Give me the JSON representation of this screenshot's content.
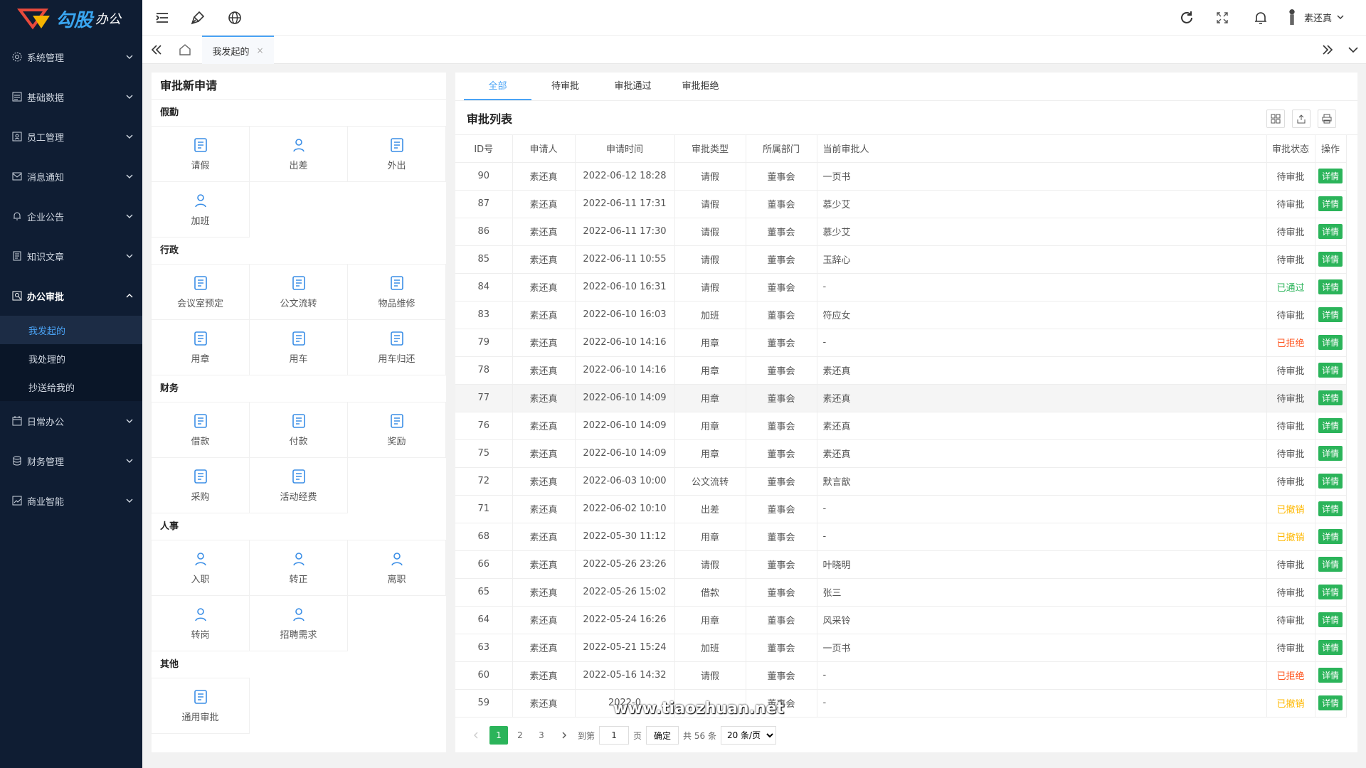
{
  "logo": {
    "brand": "勾股",
    "sub": "办公"
  },
  "sidebar": {
    "items": [
      {
        "label": "系统管理",
        "icon": "gear-icon"
      },
      {
        "label": "基础数据",
        "icon": "database-icon"
      },
      {
        "label": "员工管理",
        "icon": "badge-icon"
      },
      {
        "label": "消息通知",
        "icon": "mail-icon"
      },
      {
        "label": "企业公告",
        "icon": "bell-icon"
      },
      {
        "label": "知识文章",
        "icon": "article-icon"
      },
      {
        "label": "办公审批",
        "icon": "approval-icon",
        "open": true,
        "children": [
          {
            "label": "我发起的",
            "active": true
          },
          {
            "label": "我处理的"
          },
          {
            "label": "抄送给我的"
          }
        ]
      },
      {
        "label": "日常办公",
        "icon": "calendar-icon"
      },
      {
        "label": "财务管理",
        "icon": "finance-icon"
      },
      {
        "label": "商业智能",
        "icon": "chart-icon"
      }
    ]
  },
  "topbar": {
    "user_name": "素还真"
  },
  "tabbar": {
    "active_tab": "我发起的",
    "close": "×"
  },
  "left_panel": {
    "title": "审批新申请",
    "categories": [
      {
        "title": "假勤",
        "items": [
          "请假",
          "出差",
          "外出",
          "加班"
        ]
      },
      {
        "title": "行政",
        "items": [
          "会议室预定",
          "公文流转",
          "物品维修",
          "用章",
          "用车",
          "用车归还"
        ]
      },
      {
        "title": "财务",
        "items": [
          "借款",
          "付款",
          "奖励",
          "采购",
          "活动经费"
        ]
      },
      {
        "title": "人事",
        "items": [
          "入职",
          "转正",
          "离职",
          "转岗",
          "招聘需求"
        ]
      },
      {
        "title": "其他",
        "items": [
          "通用审批"
        ]
      }
    ]
  },
  "right_panel": {
    "tabs": [
      "全部",
      "待审批",
      "审批通过",
      "审批拒绝"
    ],
    "list_title": "审批列表",
    "columns": [
      "ID号",
      "申请人",
      "申请时间",
      "审批类型",
      "所属部门",
      "当前审批人",
      "审批状态",
      "操作"
    ],
    "detail_label": "详情",
    "rows": [
      [
        "90",
        "素还真",
        "2022-06-12 18:28",
        "请假",
        "董事会",
        "一页书",
        "待审批"
      ],
      [
        "87",
        "素还真",
        "2022-06-11 17:31",
        "请假",
        "董事会",
        "慕少艾",
        "待审批"
      ],
      [
        "86",
        "素还真",
        "2022-06-11 17:30",
        "请假",
        "董事会",
        "慕少艾",
        "待审批"
      ],
      [
        "85",
        "素还真",
        "2022-06-11 10:55",
        "请假",
        "董事会",
        "玉辞心",
        "待审批"
      ],
      [
        "84",
        "素还真",
        "2022-06-10 16:31",
        "请假",
        "董事会",
        "-",
        "已通过"
      ],
      [
        "83",
        "素还真",
        "2022-06-10 16:03",
        "加班",
        "董事会",
        "符应女",
        "待审批"
      ],
      [
        "79",
        "素还真",
        "2022-06-10 14:16",
        "用章",
        "董事会",
        "-",
        "已拒绝"
      ],
      [
        "78",
        "素还真",
        "2022-06-10 14:16",
        "用章",
        "董事会",
        "素还真",
        "待审批"
      ],
      [
        "77",
        "素还真",
        "2022-06-10 14:09",
        "用章",
        "董事会",
        "素还真",
        "待审批"
      ],
      [
        "76",
        "素还真",
        "2022-06-10 14:09",
        "用章",
        "董事会",
        "素还真",
        "待审批"
      ],
      [
        "75",
        "素还真",
        "2022-06-10 14:09",
        "用章",
        "董事会",
        "素还真",
        "待审批"
      ],
      [
        "72",
        "素还真",
        "2022-06-03 10:00",
        "公文流转",
        "董事会",
        "默言歆",
        "待审批"
      ],
      [
        "71",
        "素还真",
        "2022-06-02 10:10",
        "出差",
        "董事会",
        "-",
        "已撤销"
      ],
      [
        "68",
        "素还真",
        "2022-05-30 11:12",
        "用章",
        "董事会",
        "-",
        "已撤销"
      ],
      [
        "66",
        "素还真",
        "2022-05-26 23:26",
        "请假",
        "董事会",
        "叶晓明",
        "待审批"
      ],
      [
        "65",
        "素还真",
        "2022-05-26 15:02",
        "借款",
        "董事会",
        "张三",
        "待审批"
      ],
      [
        "64",
        "素还真",
        "2022-05-24 16:26",
        "用章",
        "董事会",
        "风采铃",
        "待审批"
      ],
      [
        "63",
        "素还真",
        "2022-05-21 15:24",
        "加班",
        "董事会",
        "一页书",
        "待审批"
      ],
      [
        "60",
        "素还真",
        "2022-05-16 14:32",
        "请假",
        "董事会",
        "-",
        "已拒绝"
      ],
      [
        "59",
        "素还真",
        "2022-0",
        "",
        "董事会",
        "-",
        "已撤销"
      ]
    ],
    "status_colors": {
      "待审批": "#555555",
      "已通过": "#2bb45a",
      "已拒绝": "#ff5722",
      "已撤销": "#ffb800"
    },
    "pager": {
      "pages": [
        "1",
        "2",
        "3"
      ],
      "goto_label": "到第",
      "goto_value": "1",
      "page_unit": "页",
      "confirm": "确定",
      "total": "共 56 条",
      "per_page": "20 条/页"
    }
  },
  "watermark": "www.tiaozhuan.net",
  "colors": {
    "sidebar_bg": "#0f1d33",
    "accent": "#4aa3f5",
    "success": "#2bb45a"
  }
}
